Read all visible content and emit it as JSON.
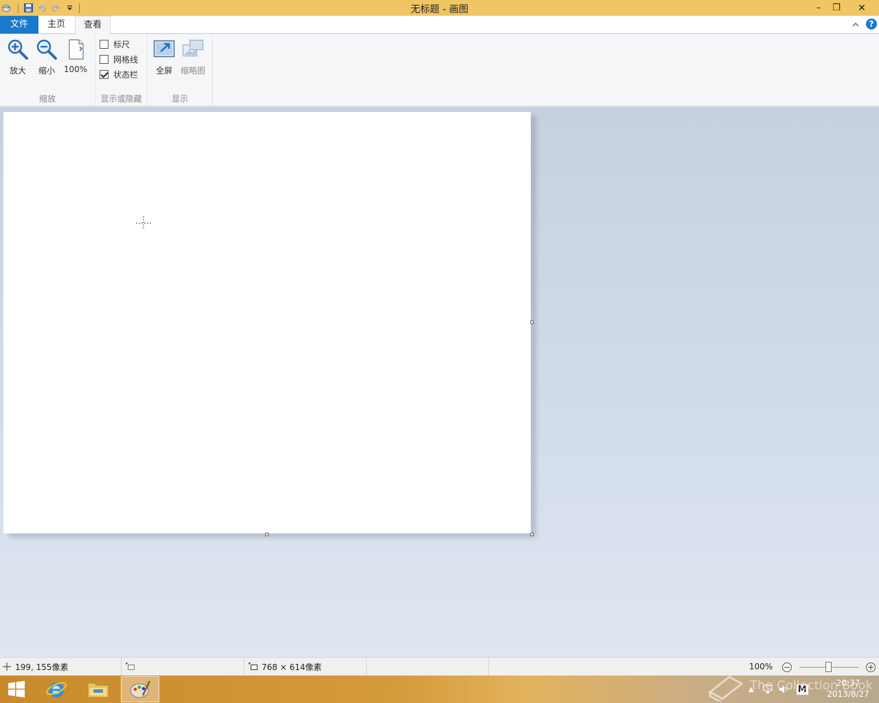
{
  "window": {
    "title": "无标题 - 画图",
    "minimize": "–",
    "restore": "❐",
    "close": "✕"
  },
  "ribbon": {
    "tabs": {
      "file": "文件",
      "home": "主页",
      "view": "查看"
    },
    "help": "?",
    "zoom_group": {
      "label": "缩放",
      "zoom_in": "放大",
      "zoom_out": "缩小",
      "actual_size": "100%"
    },
    "show_hide_group": {
      "label": "显示或隐藏",
      "rulers": {
        "label": "标尺",
        "checked": false
      },
      "gridlines": {
        "label": "网格线",
        "checked": false
      },
      "statusbar": {
        "label": "状态栏",
        "checked": true
      }
    },
    "display_group": {
      "label": "显示",
      "fullscreen": "全屏",
      "thumbnail": "缩略图"
    }
  },
  "statusbar": {
    "cursor_position": "199, 155像素",
    "selection_size": "",
    "canvas_size": "768 × 614像素",
    "zoom_level": "100%",
    "zoom_fraction": 0.5
  },
  "taskbar": {
    "time": "20:37",
    "date": "2013/8/27",
    "ime": "M"
  },
  "watermark": "The Collection Book"
}
